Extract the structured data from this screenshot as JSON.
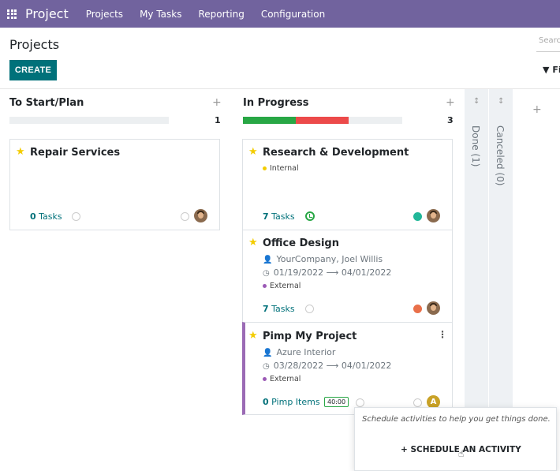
{
  "nav": {
    "brand": "Project",
    "items": [
      "Projects",
      "My Tasks",
      "Reporting",
      "Configuration"
    ]
  },
  "control_panel": {
    "title": "Projects",
    "create_label": "CREATE",
    "search_placeholder": "Search...",
    "filters_label": "Fi"
  },
  "columns": [
    {
      "title": "To Start/Plan",
      "count": "1",
      "progress": {
        "green": 0,
        "red": 0
      }
    },
    {
      "title": "In Progress",
      "count": "3",
      "progress": {
        "green": 0.33,
        "red": 0.33
      }
    }
  ],
  "folded_columns": [
    {
      "label": "Done (1)"
    },
    {
      "label": "Canceled (0)"
    }
  ],
  "cards": {
    "repair": {
      "title": "Repair Services",
      "count": "0",
      "label": "Tasks"
    },
    "research": {
      "title": "Research & Development",
      "tag": "Internal",
      "count": "7",
      "label": "Tasks"
    },
    "office": {
      "title": "Office Design",
      "partner": "YourCompany, Joel Willis",
      "date_start": "01/19/2022",
      "date_end": "04/01/2022",
      "tag": "External",
      "count": "7",
      "label": "Tasks"
    },
    "pimp": {
      "title": "Pimp My Project",
      "partner": "Azure Interior",
      "date_start": "03/28/2022",
      "date_end": "04/01/2022",
      "tag": "External",
      "count": "0",
      "label": "Pimp Items",
      "timer": "40:00",
      "avatar_letter": "A"
    }
  },
  "popover": {
    "text": "Schedule activities to help you get things done.",
    "button": "SCHEDULE AN ACTIVITY"
  },
  "colors": {
    "navbar": "#71639e",
    "primary": "#00717a",
    "progress_green": "#28a745",
    "progress_red": "#ec4a4a",
    "star": "#f3cc00",
    "tag_internal": "#f3cc00",
    "tag_external": "#9b59b6",
    "status_green": "#21b799",
    "status_red": "#e9704a"
  }
}
